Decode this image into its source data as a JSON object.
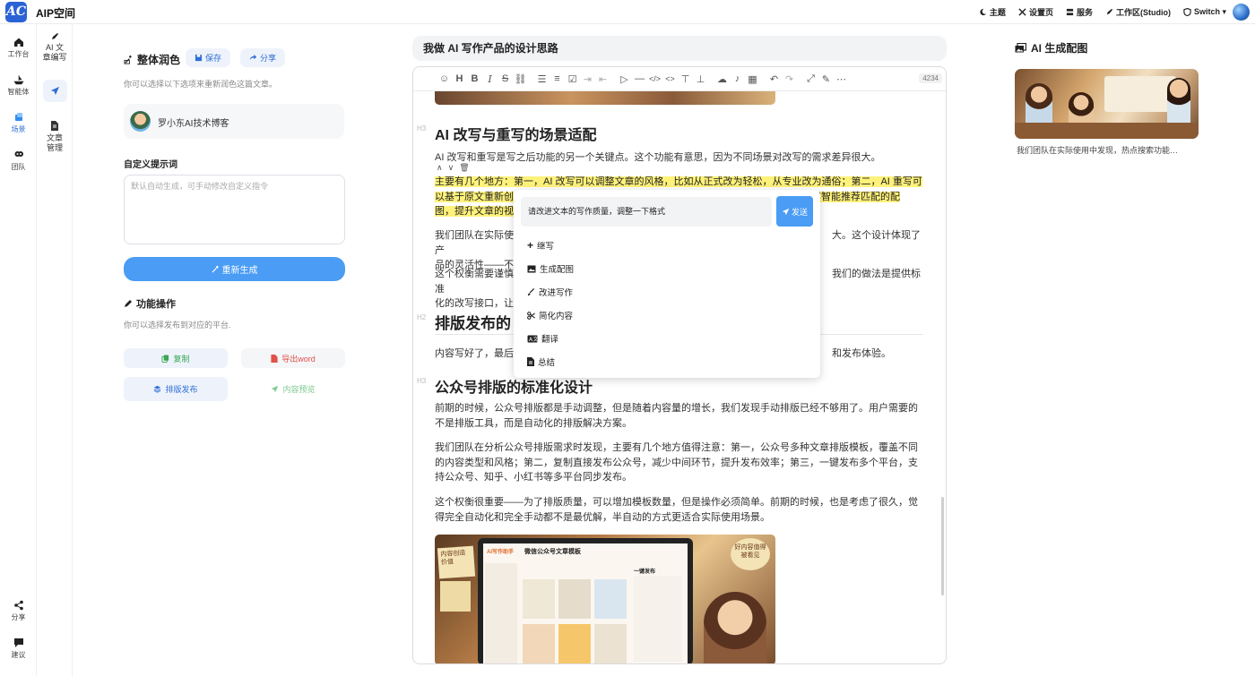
{
  "app": {
    "logo_text": "AC",
    "title": "AIP空间"
  },
  "topnav": [
    {
      "icon": "moon-icon",
      "label": "主题"
    },
    {
      "icon": "tools-icon",
      "label": "设置页"
    },
    {
      "icon": "server-icon",
      "label": "服务"
    },
    {
      "icon": "pen-icon",
      "label": "工作区(Studio)"
    },
    {
      "icon": "shield-icon",
      "label": "Switch ▾"
    }
  ],
  "rail": {
    "items": [
      {
        "icon": "home-icon",
        "label": "工作台"
      },
      {
        "icon": "ship-icon",
        "label": "智能体"
      },
      {
        "icon": "scene-icon",
        "label": "场景"
      },
      {
        "icon": "team-icon",
        "label": "团队"
      }
    ],
    "bottom": [
      {
        "icon": "share-icon",
        "label": "分享"
      },
      {
        "icon": "message-icon",
        "label": "建议"
      }
    ]
  },
  "rail2": {
    "items": [
      {
        "icon": "pen-icon",
        "label": "AI 文章编写"
      },
      {
        "icon": "send-icon",
        "label": ""
      },
      {
        "icon": "doc-icon",
        "label": "文章管理"
      }
    ]
  },
  "left_panel": {
    "title": "整体润色",
    "save_label": "保存",
    "share_label": "分享",
    "subtitle": "你可以选择以下选项来重新润色这篇文章。",
    "account_name": "罗小东AI技术博客",
    "prompt_label": "自定义提示词",
    "prompt_placeholder": "默认自动生成，可手动修改自定义指令",
    "regenerate_label": "重新生成",
    "ops_title": "功能操作",
    "ops_subtitle": "你可以选择发布到对应的平台.",
    "copy_label": "复制",
    "export_label": "导出word",
    "publish_label": "排版发布",
    "preview_label": "内容预览"
  },
  "editor": {
    "title": "我做 AI 写作产品的设计思路",
    "word_count": "4234",
    "h3_tag": "H3",
    "h2_tag": "H2",
    "sections": {
      "s1_heading": "AI 改写与重写的场景适配",
      "s1_p1": "AI 改写和重写是写之后功能的另一个关键点。这个功能有意思，因为不同场景对改写的需求差异很大。",
      "s1_hl_line1": "主要有几个地方：第一，AI 改写可以调整文章的风格，比如从正式改为轻松，从专业改为通俗；第二，AI 重写可",
      "s1_hl_line2a": "以基于原文重新创",
      "s1_hl_line2b": "容智能推荐匹配的配",
      "s1_hl_line3": "图，提升文章的视",
      "s1_p3a": "我们团队在实际使",
      "s1_p3b": "大。这个设计体现了产",
      "s1_p3c": "品的灵活性——不",
      "s1_p4a": "这个权衡需要谨慎",
      "s1_p4b": "我们的做法是提供标准",
      "s1_p4c": "化的改写接口，让",
      "s2_heading": "排版发布的",
      "s2_p1a": "内容写好了，最后",
      "s2_p1b": "和发布体验。",
      "s3_heading": "公众号排版的标准化设计",
      "s3_p1": "前期的时候，公众号排版都是手动调整，但是随着内容量的增长，我们发现手动排版已经不够用了。用户需要的不是排版工具，而是自动化的排版解决方案。",
      "s3_p2": "我们团队在分析公众号排版需求时发现，主要有几个地方值得注意：第一，公众号多种文章排版模板，覆盖不同的内容类型和风格；第二，复制直接发布公众号，减少中间环节，提升发布效率；第三，一键发布多个平台，支持公众号、知乎、小红书等多平台同步发布。",
      "s3_p3": "这个权衡很重要——为了排版质量，可以增加模板数量，但是操作必须简单。前期的时候，也是考虑了很久，觉得完全自动化和完全手动都不是最优解，半自动的方式更适合实际使用场景。"
    },
    "image_texts": {
      "app_name": "AI写作助手",
      "template_title": "微信公众号文章模板",
      "note_left": "内容创造价值",
      "note_right": "好内容值得被看见",
      "publish_panel": "一键发布"
    }
  },
  "popup": {
    "input_value": "请改进文本的写作质量，调整一下格式",
    "send_label": "发送",
    "items": [
      {
        "icon": "plus-icon",
        "label": "继写"
      },
      {
        "icon": "image-icon",
        "label": "生成配图"
      },
      {
        "icon": "brush-icon",
        "label": "改进写作"
      },
      {
        "icon": "scissors-icon",
        "label": "简化内容"
      },
      {
        "icon": "translate-icon",
        "label": "翻译"
      },
      {
        "icon": "file-icon",
        "label": "总结"
      }
    ]
  },
  "right_panel": {
    "title": "AI 生成配图",
    "caption": "我们团队在实际使用中发现，热点搜索功能…"
  },
  "colors": {
    "accent": "#4a9cf5",
    "highlight": "#fff27a",
    "brand": "#2a63d6"
  }
}
